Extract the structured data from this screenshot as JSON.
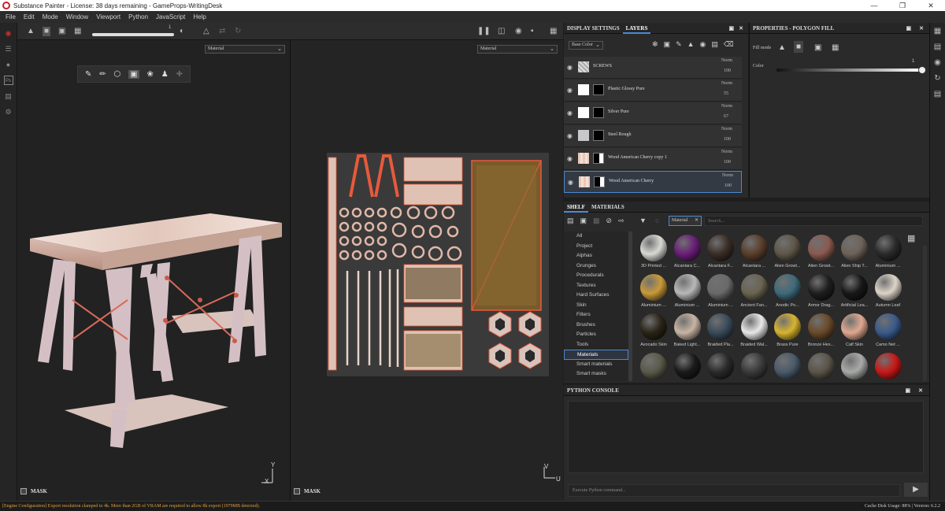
{
  "window": {
    "title": "Substance Painter - License: 38 days remaining - GameProps-WritingDesk"
  },
  "menu": [
    "File",
    "Edit",
    "Mode",
    "Window",
    "Viewport",
    "Python",
    "JavaScript",
    "Help"
  ],
  "toolbar": {
    "brush_value": "1"
  },
  "viewport3d": {
    "channel": "Material",
    "mask_label": "MASK",
    "axis_y": "Y",
    "axis_x": "X"
  },
  "viewport2d": {
    "channel": "Material",
    "mask_label": "MASK",
    "axis_v": "V",
    "axis_u": "U"
  },
  "layers_panel": {
    "tabs": [
      "DISPLAY SETTINGS",
      "LAYERS"
    ],
    "channel": "Base Color",
    "layers": [
      {
        "name": "SCREWS",
        "blend": "Norm",
        "opacity": "100"
      },
      {
        "name": "Plastic Glossy Pure",
        "blend": "Norm",
        "opacity": "55"
      },
      {
        "name": "Silver Pure",
        "blend": "Norm",
        "opacity": "67"
      },
      {
        "name": "Steel Rough",
        "blend": "Norm",
        "opacity": "100"
      },
      {
        "name": "Wood American Cherry copy 1",
        "blend": "Norm",
        "opacity": "100"
      },
      {
        "name": "Wood American Cherry",
        "blend": "Norm",
        "opacity": "100"
      }
    ]
  },
  "properties": {
    "title": "PROPERTIES - POLYGON FILL",
    "fill_mode_label": "Fill mode",
    "color_label": "Color",
    "color_value": "1"
  },
  "shelf": {
    "tabs": [
      "SHELF",
      "MATERIALS"
    ],
    "filter_tag": "Material",
    "search_placeholder": "Search...",
    "categories": [
      "All",
      "Project",
      "Alphas",
      "Grunges",
      "Procedurals",
      "Textures",
      "Hard Surfaces",
      "Skin",
      "Filters",
      "Brushes",
      "Particles",
      "Tools",
      "Materials",
      "Smart materials",
      "Smart masks"
    ],
    "selected_category": "Materials",
    "materials": [
      {
        "name": "3D Printed ...",
        "color": "#d8d8d4"
      },
      {
        "name": "Alcantara C...",
        "color": "#6a1e78"
      },
      {
        "name": "Alcantara F...",
        "color": "#3a2e26"
      },
      {
        "name": "Alcantara ...",
        "color": "#5a3e2c"
      },
      {
        "name": "Alien Growt...",
        "color": "#5e5648"
      },
      {
        "name": "Alien Growt...",
        "color": "#8a5a50"
      },
      {
        "name": "Alien Ship T...",
        "color": "#6e6258"
      },
      {
        "name": "Aluminium ...",
        "color": "#2a2a2a"
      },
      {
        "name": "Aluminium ...",
        "color": "#c89a3a"
      },
      {
        "name": "Aluminium ...",
        "color": "#b8b8b8"
      },
      {
        "name": "Aluminium ...",
        "color": "#6a6a6a"
      },
      {
        "name": "Ancient Fan...",
        "color": "#6a6450"
      },
      {
        "name": "Anodic Po...",
        "color": "#3e6a7a"
      },
      {
        "name": "Armor Drag...",
        "color": "#1e1e1e"
      },
      {
        "name": "Artificial Lea...",
        "color": "#181818"
      },
      {
        "name": "Autumn Leaf",
        "color": "#ddd4c8"
      },
      {
        "name": "Avocado Skin",
        "color": "#2a2418"
      },
      {
        "name": "Baked Light...",
        "color": "#c8b4a4"
      },
      {
        "name": "Braided Pla...",
        "color": "#3a4a5a"
      },
      {
        "name": "Braided Wal...",
        "color": "#e8e8e8"
      },
      {
        "name": "Brass Pure",
        "color": "#d8b430"
      },
      {
        "name": "Bronze Hex...",
        "color": "#6a4a2a"
      },
      {
        "name": "Calf Skin",
        "color": "#e0a890"
      },
      {
        "name": "Camo Net ...",
        "color": "#3a5a8a"
      },
      {
        "name": "",
        "color": "#5a5a4a"
      },
      {
        "name": "",
        "color": "#1a1a1a"
      },
      {
        "name": "",
        "color": "#2a2a2a"
      },
      {
        "name": "",
        "color": "#3a3a3a"
      },
      {
        "name": "",
        "color": "#4a5a6a"
      },
      {
        "name": "",
        "color": "#5a5448"
      },
      {
        "name": "",
        "color": "#a8aaa8"
      },
      {
        "name": "",
        "color": "#c81818"
      }
    ]
  },
  "console": {
    "title": "PYTHON CONSOLE",
    "placeholder": "Execute Python command..."
  },
  "status": {
    "message": "[Engine Configuration] Export resolution clamped to 4k. More than 2GB of VRAM are required to allow 8k export (1979MB detected).",
    "right": "Cache Disk Usage:   88% | Version: 6.2.2"
  },
  "colors": {
    "accent": "#4a8ad4",
    "warning": "#e0a040",
    "wood": "#e6d2c8",
    "uv_highlight": "#e85a3a"
  }
}
